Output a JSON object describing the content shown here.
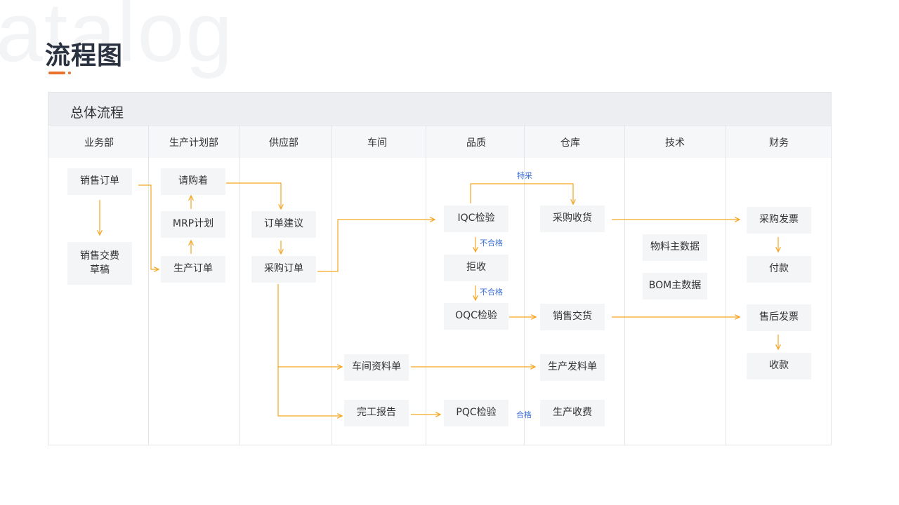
{
  "watermark": "atalog",
  "page": {
    "title": "流程图"
  },
  "panel": {
    "title": "总体流程"
  },
  "lanes": [
    "业务部",
    "生产计划部",
    "供应部",
    "车间",
    "品质",
    "仓库",
    "技术",
    "财务"
  ],
  "nodes": {
    "sales_order": "销售订单",
    "sales_delivery_draft": "销售交费\n草稿",
    "purchase_request": "请购着",
    "mrp_plan": "MRP计划",
    "production_order": "生产订单",
    "order_suggestion": "订单建议",
    "purchase_order": "采购订单",
    "workshop_material_sheet": "车间资料单",
    "completion_report": "完工报告",
    "iqc_inspection": "IQC检验",
    "reject": "拒收",
    "oqc_inspection": "OQC检验",
    "pqc_inspection": "PQC检验",
    "purchase_receipt": "采购收货",
    "sales_delivery": "销售交货",
    "production_issue_sheet": "生产发料单",
    "production_receipt": "生产收费",
    "material_master": "物料主数据",
    "bom_master": "BOM主数据",
    "purchase_invoice": "采购发票",
    "payment": "付款",
    "aftersale_invoice": "售后发票",
    "collection": "收款"
  },
  "flow_labels": {
    "special_purchase": "特采",
    "unqualified_1": "不合格",
    "unqualified_2": "不合格",
    "qualified": "合格"
  },
  "colors": {
    "arrow": "#f5a623",
    "flow_label": "#3a6fd8",
    "accent": "#e8722c",
    "node_bg": "#f4f5f7",
    "header_bg": "#eceef2"
  }
}
